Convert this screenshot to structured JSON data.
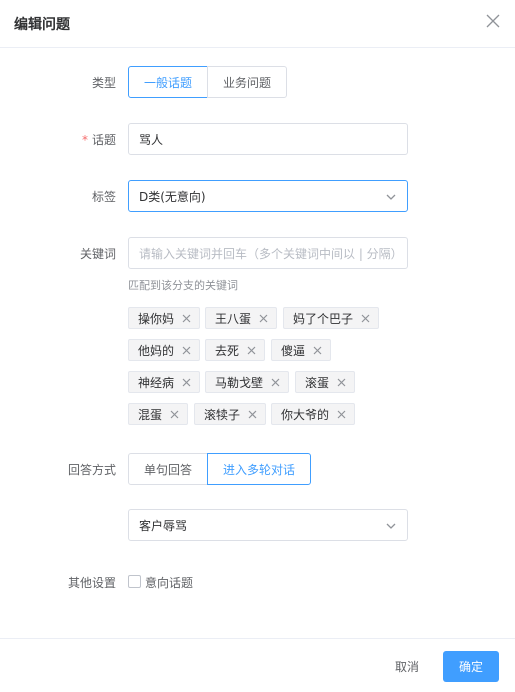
{
  "dialog": {
    "title": "编辑问题"
  },
  "form": {
    "type": {
      "label": "类型",
      "options": [
        "一般话题",
        "业务问题"
      ]
    },
    "topic": {
      "label": "话题",
      "required_mark": "*",
      "value": "骂人"
    },
    "tag": {
      "label": "标签",
      "value": "D类(无意向)"
    },
    "keywords": {
      "label": "关键词",
      "placeholder": "请输入关键词并回车（多个关键词中间以 | 分隔）",
      "hint": "匹配到该分支的关键词",
      "tags": [
        "操你妈",
        "王八蛋",
        "妈了个巴子",
        "他妈的",
        "去死",
        "傻逼",
        "神经病",
        "马勒戈壁",
        "滚蛋",
        "混蛋",
        "滚犊子",
        "你大爷的"
      ]
    },
    "answer_mode": {
      "label": "回答方式",
      "options": [
        "单句回答",
        "进入多轮对话"
      ],
      "flow_value": "客户辱骂"
    },
    "other": {
      "label": "其他设置",
      "checkbox_label": "意向话题"
    }
  },
  "footer": {
    "cancel": "取消",
    "confirm": "确定"
  },
  "colors": {
    "primary": "#409eff",
    "required": "#f56c6c",
    "border": "#dcdfe6"
  }
}
